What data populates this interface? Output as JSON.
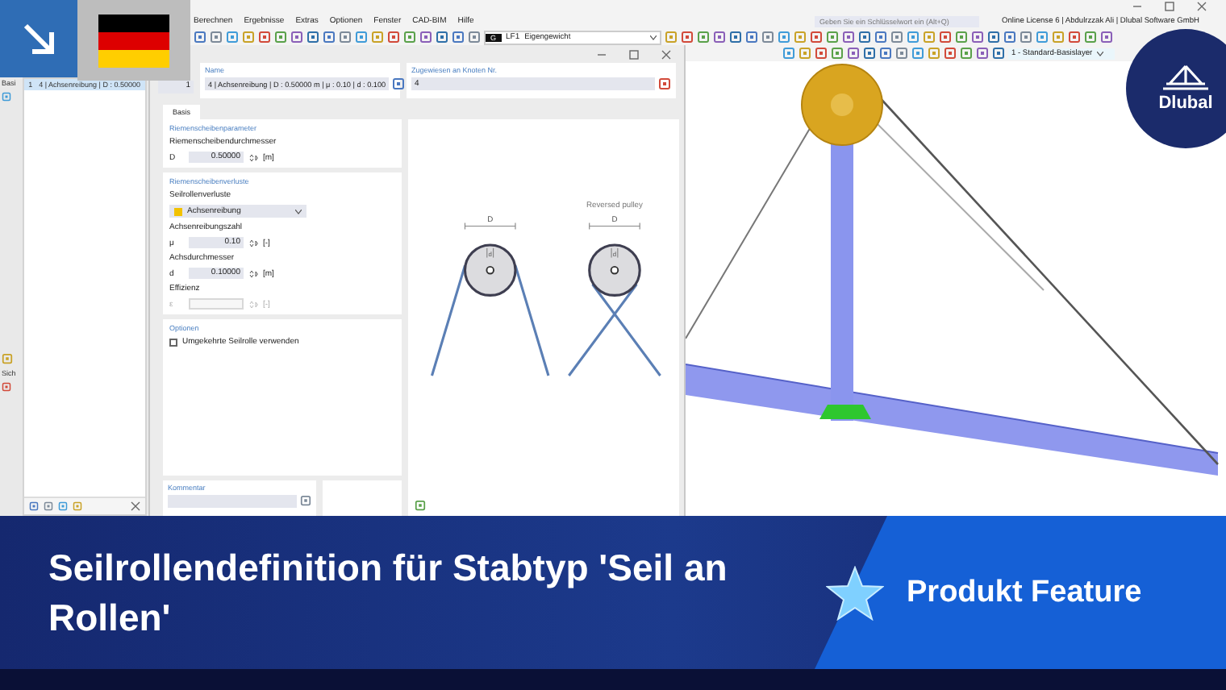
{
  "menu": [
    "Berechnen",
    "Ergebnisse",
    "Extras",
    "Optionen",
    "Fenster",
    "CAD-BIM",
    "Hilfe"
  ],
  "search": {
    "placeholder": "Geben Sie ein Schlüsselwort ein (Alt+Q)"
  },
  "license": "Online License 6 | Abdulrzzak Ali | Dlubal Software GmbH",
  "load_case": {
    "code": "G",
    "number": "LF1",
    "name": "Eigengewicht"
  },
  "layer": "1 - Standard-Basislayer",
  "navigator": {
    "side_labels": [
      "Basi",
      "Sich"
    ],
    "items": [
      {
        "number": "1",
        "label": "4 | Achsenreibung | D : 0.50000",
        "selected": true
      }
    ]
  },
  "dialog": {
    "number": "1",
    "name": {
      "label": "Name",
      "value": "4 | Achsenreibung | D : 0.50000 m | μ : 0.10 | d : 0.100"
    },
    "assigned": {
      "label": "Zugewiesen an Knoten Nr.",
      "value": "4"
    },
    "tabs": [
      {
        "label": "Basis",
        "selected": true
      }
    ],
    "sections": [
      {
        "title": "Riemenscheibenparameter",
        "rows": [
          {
            "kind": "caption",
            "text": "Riemenscheibendurchmesser"
          },
          {
            "kind": "number",
            "symbol": "D",
            "value": "0.50000",
            "unit": "[m]",
            "disabled": false
          }
        ]
      },
      {
        "title": "Riemenscheibenverluste",
        "rows": [
          {
            "kind": "caption",
            "text": "Seilrollenverluste"
          },
          {
            "kind": "select",
            "value": "Achsenreibung",
            "color": "#f2c200"
          },
          {
            "kind": "caption",
            "text": "Achsenreibungszahl"
          },
          {
            "kind": "number",
            "symbol": "μ",
            "value": "0.10",
            "unit": "[-]",
            "disabled": false
          },
          {
            "kind": "caption",
            "text": "Achsdurchmesser"
          },
          {
            "kind": "number",
            "symbol": "d",
            "value": "0.10000",
            "unit": "[m]",
            "disabled": false
          },
          {
            "kind": "caption",
            "text": "Effizienz"
          },
          {
            "kind": "number",
            "symbol": "ε",
            "unit": "[-]",
            "disabled": true
          }
        ]
      },
      {
        "title": "Optionen",
        "rows": [
          {
            "kind": "checkbox",
            "text": "Umgekehrte Seilrolle verwenden",
            "checked": false
          }
        ]
      }
    ],
    "comment": {
      "label": "Kommentar"
    },
    "figure": {
      "pulleys": [
        {
          "kind": "normal",
          "outer_label": "D",
          "inner_label": "d"
        },
        {
          "kind": "reversed",
          "caption": "Reversed pulley",
          "outer_label": "D",
          "inner_label": "d"
        }
      ]
    }
  },
  "logo": {
    "text": "Dlubal"
  },
  "banner": {
    "title": "Seilrollendefinition für Stabtyp 'Seil an Rollen'",
    "tag": "Produkt Feature"
  }
}
